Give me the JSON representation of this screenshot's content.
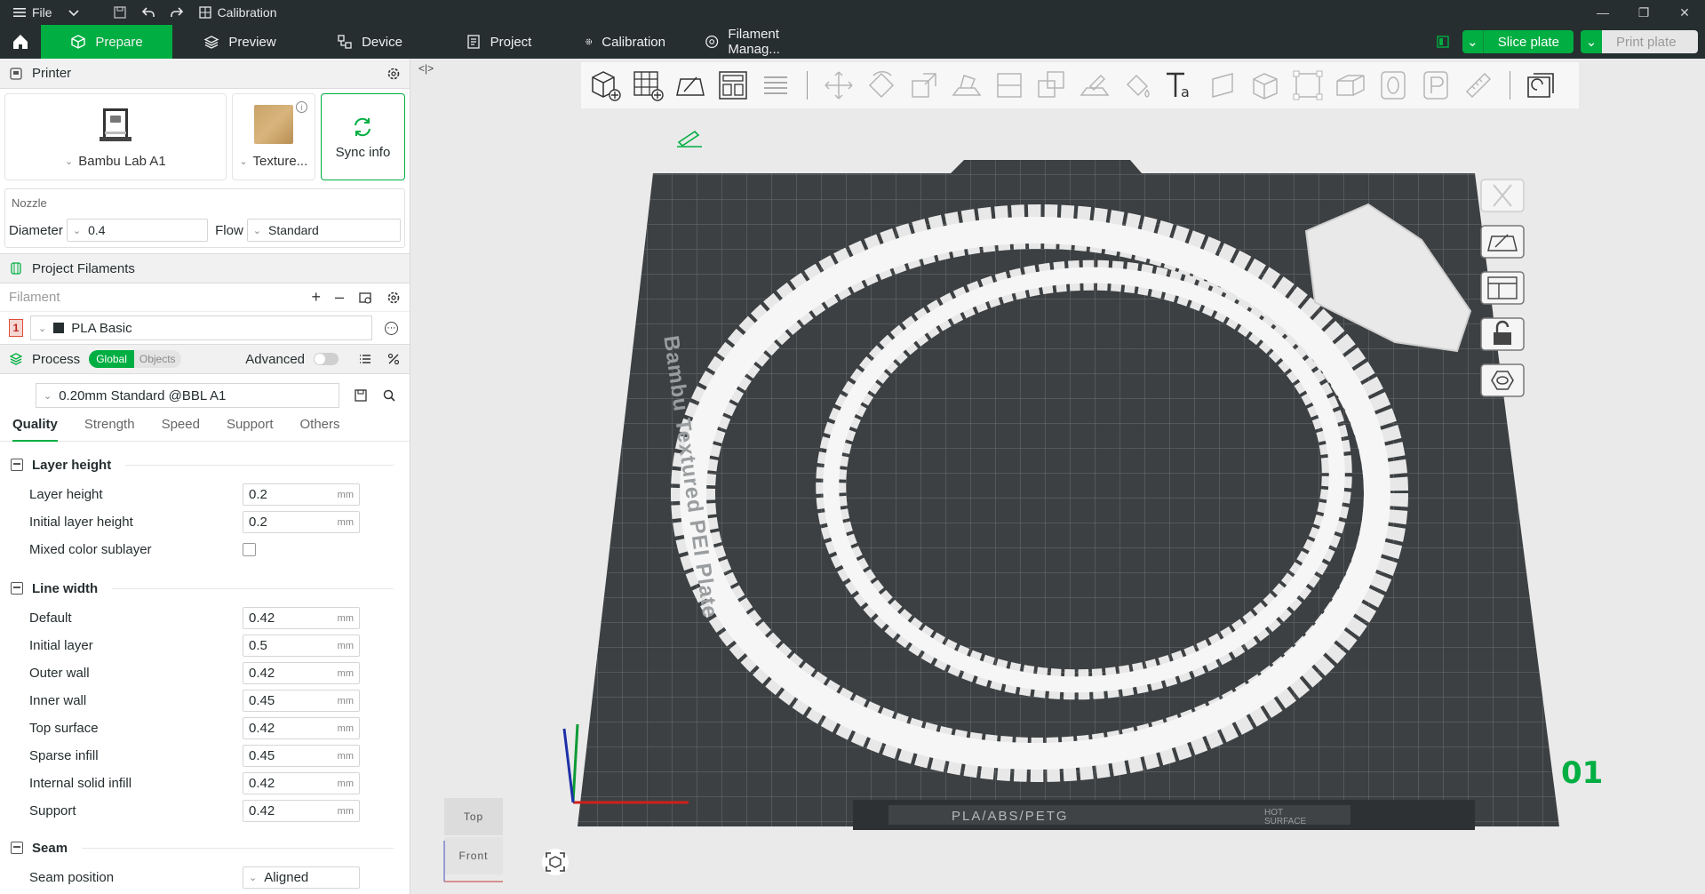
{
  "titlebar": {
    "file_label": "File",
    "calibration_label": "Calibration"
  },
  "tabs": {
    "prepare": "Prepare",
    "preview": "Preview",
    "device": "Device",
    "project": "Project",
    "calibration": "Calibration",
    "filament": "Filament Manag..."
  },
  "actions": {
    "slice": "Slice plate",
    "print": "Print plate"
  },
  "printer": {
    "header": "Printer",
    "name": "Bambu Lab A1",
    "plate": "Texture...",
    "sync": "Sync info",
    "nozzle_title": "Nozzle",
    "diameter_label": "Diameter",
    "diameter_value": "0.4",
    "flow_label": "Flow",
    "flow_value": "Standard"
  },
  "filaments": {
    "header": "Project Filaments",
    "sub_label": "Filament",
    "items": [
      {
        "num": "1",
        "name": "PLA Basic"
      }
    ]
  },
  "process": {
    "header": "Process",
    "global": "Global",
    "objects": "Objects",
    "advanced": "Advanced",
    "preset": "0.20mm Standard @BBL A1",
    "tabs": [
      "Quality",
      "Strength",
      "Speed",
      "Support",
      "Others"
    ],
    "groups": {
      "layer_height": {
        "title": "Layer height",
        "rows": [
          {
            "label": "Layer height",
            "value": "0.2",
            "unit": "mm"
          },
          {
            "label": "Initial layer height",
            "value": "0.2",
            "unit": "mm"
          }
        ],
        "mixed_label": "Mixed color sublayer"
      },
      "line_width": {
        "title": "Line width",
        "rows": [
          {
            "label": "Default",
            "value": "0.42",
            "unit": "mm"
          },
          {
            "label": "Initial layer",
            "value": "0.5",
            "unit": "mm"
          },
          {
            "label": "Outer wall",
            "value": "0.42",
            "unit": "mm"
          },
          {
            "label": "Inner wall",
            "value": "0.45",
            "unit": "mm"
          },
          {
            "label": "Top surface",
            "value": "0.42",
            "unit": "mm"
          },
          {
            "label": "Sparse infill",
            "value": "0.45",
            "unit": "mm"
          },
          {
            "label": "Internal solid infill",
            "value": "0.42",
            "unit": "mm"
          },
          {
            "label": "Support",
            "value": "0.42",
            "unit": "mm"
          }
        ]
      },
      "seam": {
        "title": "Seam",
        "position_label": "Seam position",
        "position_value": "Aligned"
      }
    }
  },
  "scene": {
    "plate_text": "Bambu Textured PEI Plate",
    "bottom_label": "PLA/ABS/PETG",
    "hot_surface": "HOT SURFACE",
    "plate_number": "01",
    "viewcube_top": "Top",
    "viewcube_front": "Front"
  },
  "colors": {
    "accent": "#00ae42",
    "titlebar": "#262e30",
    "bed": "#3d4042"
  }
}
